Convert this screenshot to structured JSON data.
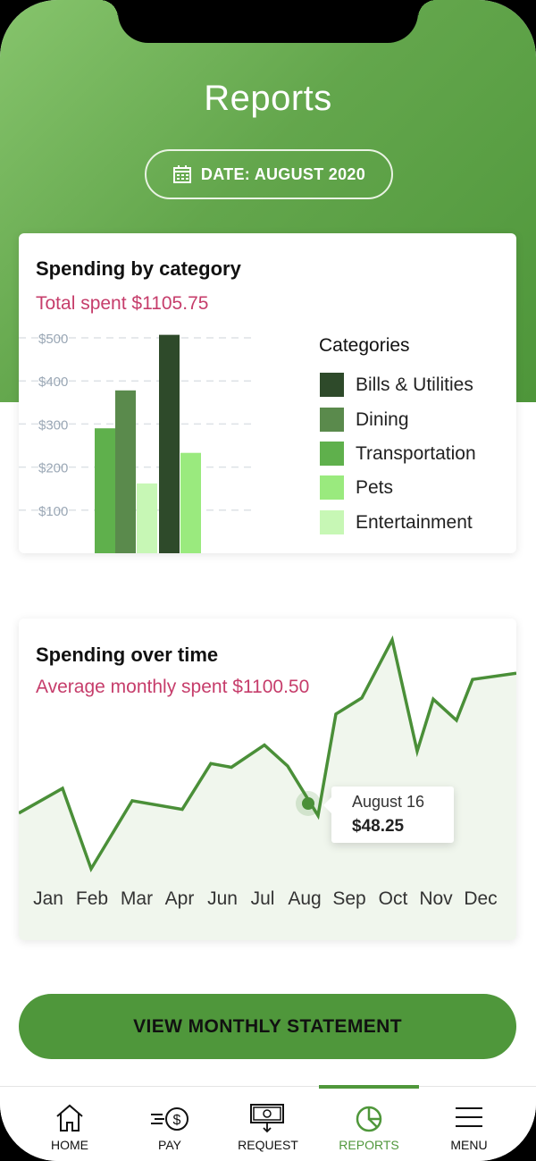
{
  "header": {
    "title": "Reports",
    "date_label": "DATE: AUGUST 2020"
  },
  "colors": {
    "brand_green": "#4f973b",
    "accent_pink": "#c63d6b",
    "bills": "#2e4a2a",
    "dining": "#5a8a4c",
    "transportation": "#5fb04c",
    "pets": "#9aea7e",
    "entertainment": "#c7f7b5"
  },
  "spending_by_category": {
    "title": "Spending by category",
    "subtitle": "Total spent $1105.75",
    "legend_title": "Categories",
    "legend": [
      {
        "name": "Bills & Utilities",
        "color": "#2e4a2a"
      },
      {
        "name": "Dining",
        "color": "#5a8a4c"
      },
      {
        "name": "Transportation",
        "color": "#5fb04c"
      },
      {
        "name": "Pets",
        "color": "#9aea7e"
      },
      {
        "name": "Entertainment",
        "color": "#c7f7b5"
      }
    ]
  },
  "spending_over_time": {
    "title": "Spending over time",
    "subtitle": "Average monthly spent $1100.50",
    "tooltip": {
      "date": "August 16",
      "value": "$48.25"
    }
  },
  "chart_data": [
    {
      "type": "bar",
      "title": "Spending by category",
      "ylim": [
        0,
        560
      ],
      "y_ticks": [
        "$100",
        "$200",
        "$300",
        "$400",
        "$500"
      ],
      "y_tick_values": [
        100,
        200,
        300,
        400,
        500
      ],
      "series": [
        {
          "name": "Transportation",
          "value": 290,
          "color": "#5fb04c"
        },
        {
          "name": "Dining",
          "value": 378,
          "color": "#5a8a4c"
        },
        {
          "name": "Entertainment",
          "value": 162,
          "color": "#c7f7b5"
        },
        {
          "name": "Bills & Utilities",
          "value": 507,
          "color": "#2e4a2a"
        },
        {
          "name": "Pets",
          "value": 233,
          "color": "#9aea7e"
        }
      ]
    },
    {
      "type": "line",
      "title": "Spending over time",
      "x_labels": [
        "Jan",
        "Feb",
        "Mar",
        "Apr",
        "Jun",
        "Jul",
        "Aug",
        "Sep",
        "Oct",
        "Nov",
        "Dec"
      ],
      "values": [
        1050,
        1070,
        1005,
        1060,
        1053,
        1090,
        1087,
        1105,
        1088,
        1048,
        1130,
        1143,
        1190,
        1100,
        1142,
        1125,
        1158,
        1163
      ],
      "highlight": {
        "label": "August 16",
        "value": "$48.25"
      }
    }
  ],
  "actions": {
    "statement_button": "VIEW MONTHLY STATEMENT"
  },
  "tabbar": [
    {
      "label": "HOME",
      "icon": "home-icon",
      "active": false
    },
    {
      "label": "PAY",
      "icon": "pay-icon",
      "active": false
    },
    {
      "label": "REQUEST",
      "icon": "request-icon",
      "active": false
    },
    {
      "label": "REPORTS",
      "icon": "reports-icon",
      "active": true
    },
    {
      "label": "MENU",
      "icon": "menu-icon",
      "active": false
    }
  ]
}
